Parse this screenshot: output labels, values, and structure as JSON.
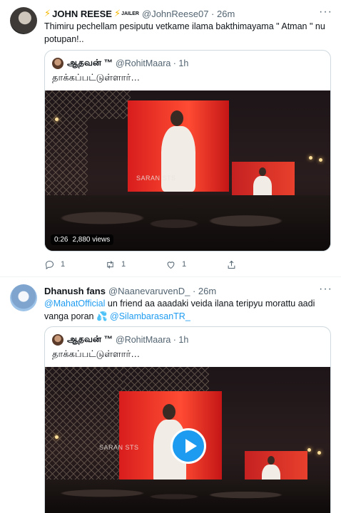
{
  "tweets": [
    {
      "name": "JOHN REESE",
      "name_prefix": "⚡",
      "name_suffix": "⚡",
      "badge": "JAILER",
      "handle": "@JohnReese07 · 26m",
      "text": "Thimiru pechellam pesiputu vetkame ilama bakthimayama \" Atman \" nu potupan!..",
      "quote": {
        "name": "ஆதவன் ™",
        "handle": "@RohitMaara · 1h",
        "text": "தாக்கப்பட்டுள்ளார்…",
        "watermark": "SARAN STS",
        "duration": "0:26",
        "views": "2,880 views"
      },
      "actions": {
        "replies": "1",
        "retweets": "1",
        "likes": "1"
      }
    },
    {
      "name": "Dhanush fans",
      "handle": "@NaanevaruvenD_ · 26m",
      "mention1": "@MahatOfficial",
      "text_mid": " un friend aa aaadaki veida ilana teripyu morattu aadi vanga poran ",
      "emoji": "💦",
      "mention2": " @SilambarasanTR_",
      "quote": {
        "name": "ஆதவன் ™",
        "handle": "@RohitMaara · 1h",
        "text": "தாக்கப்பட்டுள்ளார்…",
        "watermark": "SARAN STS"
      }
    }
  ],
  "more_label": "···"
}
